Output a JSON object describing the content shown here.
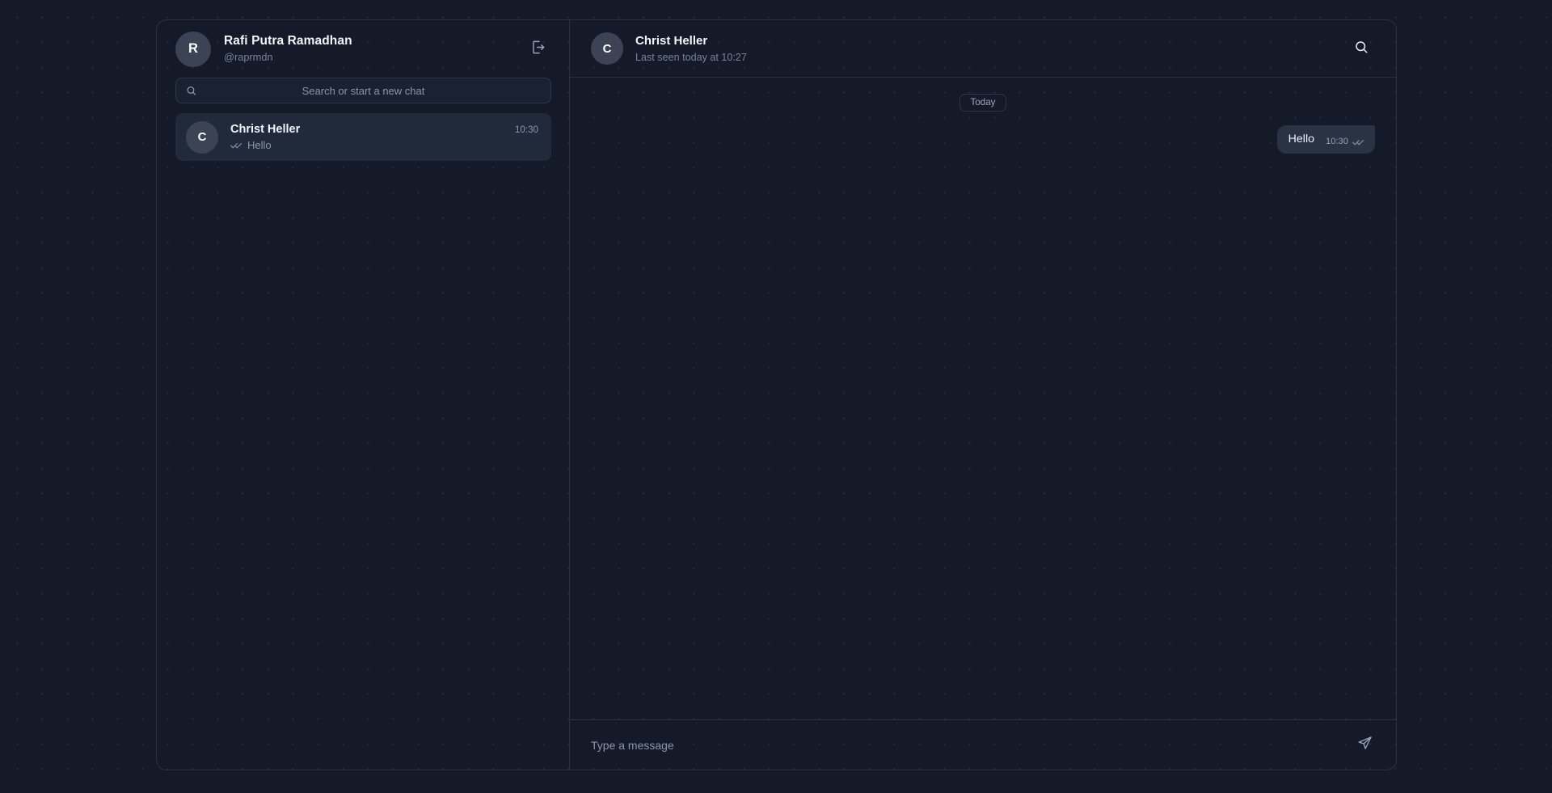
{
  "theme": {
    "page_background": "#141a27",
    "card_background": "transparent",
    "border_color": "#2a3346",
    "accent_selected_row": "#212a3a",
    "bubble_outgoing": "#2a3344",
    "text_primary": "#f2f5fa",
    "text_muted": "#8b96ac",
    "avatar_background": "#3b4355"
  },
  "sidebar": {
    "profile": {
      "avatar_initial": "R",
      "name": "Rafi Putra Ramadhan",
      "handle": "@raprmdn"
    },
    "logout_icon": "logout-icon",
    "search": {
      "icon": "search-icon",
      "placeholder": "Search or start a new chat",
      "value": ""
    },
    "chats": [
      {
        "avatar_initial": "C",
        "name": "Christ Heller",
        "time": "10:30",
        "status_icon": "double-check-icon",
        "snippet": "Hello",
        "selected": true
      }
    ]
  },
  "chat": {
    "header": {
      "avatar_initial": "C",
      "name": "Christ Heller",
      "status": "Last seen today at 10:27",
      "search_icon": "search-icon"
    },
    "day_divider": "Today",
    "messages": [
      {
        "direction": "outgoing",
        "text": "Hello",
        "time": "10:30",
        "status_icon": "double-check-icon"
      }
    ],
    "composer": {
      "placeholder": "Type a message",
      "value": "",
      "send_icon": "send-icon"
    }
  }
}
